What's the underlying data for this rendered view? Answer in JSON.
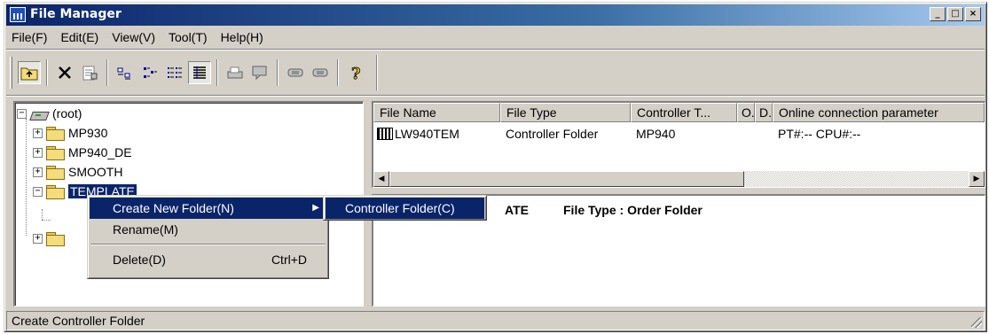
{
  "window": {
    "title": "File Manager",
    "controls": {
      "minimize": "_",
      "maximize": "□",
      "close": "×"
    }
  },
  "menubar": [
    "File(F)",
    "Edit(E)",
    "View(V)",
    "Tool(T)",
    "Help(H)"
  ],
  "toolbar": {
    "buttons": [
      "up-folder-icon",
      "delete-icon",
      "properties-icon",
      "large-icons-icon",
      "small-icons-icon",
      "list-view-icon",
      "details-view-icon",
      "print-icon",
      "comment-icon",
      "connect-icon",
      "disconnect-icon",
      "help-icon"
    ]
  },
  "tree": {
    "root": "(root)",
    "children": [
      "MP930",
      "MP940_DE",
      "SMOOTH",
      "TEMPLATE"
    ]
  },
  "list": {
    "columns": [
      "File Name",
      "File Type",
      "Controller T...",
      "O.",
      "D.",
      "Online connection parameter"
    ],
    "rows": [
      {
        "name": "LW940TEM",
        "type": "Controller Folder",
        "controller": "MP940",
        "o": "",
        "d": "",
        "params": "PT#:-- CPU#:--"
      }
    ]
  },
  "info": {
    "name_fragment": "ATE",
    "file_type": "File Type : Order Folder"
  },
  "context_menu": {
    "items": [
      {
        "label": "Create New Folder(N)",
        "shortcut": "",
        "submenu": true
      },
      {
        "label": "Rename(M)",
        "shortcut": ""
      },
      {
        "label": "Delete(D)",
        "shortcut": "Ctrl+D"
      }
    ]
  },
  "submenu": {
    "items": [
      {
        "label": "Controller Folder(C)"
      }
    ]
  },
  "statusbar": {
    "text": "Create Controller Folder"
  },
  "colors": {
    "titlebar": "#0a246a",
    "selection": "#0a246a",
    "face": "#d4d0c8"
  }
}
